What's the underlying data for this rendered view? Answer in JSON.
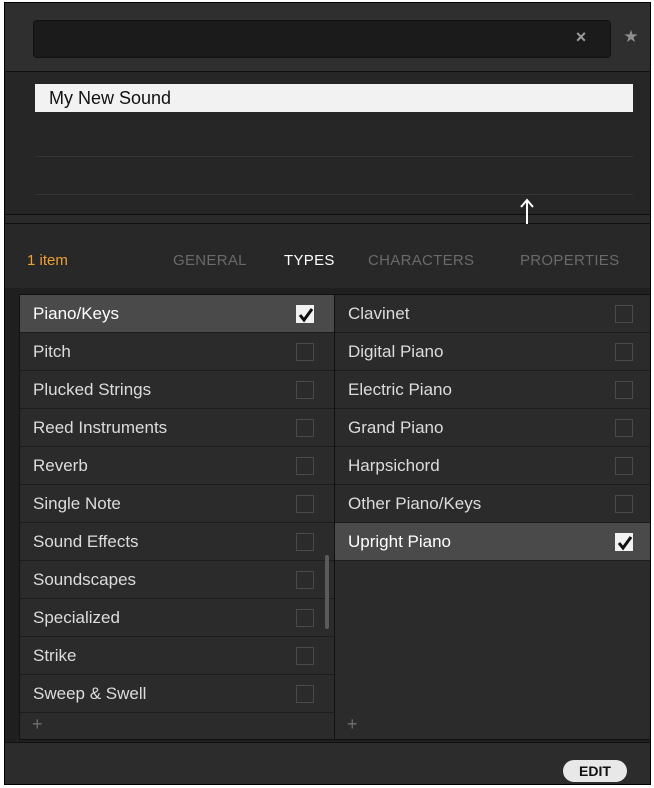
{
  "search": {
    "value": "",
    "placeholder": ""
  },
  "icons": {
    "clear": "×",
    "favorite": "★",
    "add": "+"
  },
  "results": [
    {
      "label": "My New Sound",
      "selected": true
    }
  ],
  "tags_header": {
    "item_count": "1 item",
    "tabs": [
      {
        "label": "GENERAL",
        "active": false
      },
      {
        "label": "TYPES",
        "active": true
      },
      {
        "label": "CHARACTERS",
        "active": false
      },
      {
        "label": "PROPERTIES",
        "active": false
      }
    ]
  },
  "left_column": [
    {
      "label": "Piano/Keys",
      "checked": true,
      "selected": true
    },
    {
      "label": "Pitch",
      "checked": false,
      "selected": false
    },
    {
      "label": "Plucked Strings",
      "checked": false,
      "selected": false
    },
    {
      "label": "Reed Instruments",
      "checked": false,
      "selected": false
    },
    {
      "label": "Reverb",
      "checked": false,
      "selected": false
    },
    {
      "label": "Single Note",
      "checked": false,
      "selected": false
    },
    {
      "label": "Sound Effects",
      "checked": false,
      "selected": false
    },
    {
      "label": "Soundscapes",
      "checked": false,
      "selected": false
    },
    {
      "label": "Specialized",
      "checked": false,
      "selected": false
    },
    {
      "label": "Strike",
      "checked": false,
      "selected": false
    },
    {
      "label": "Sweep & Swell",
      "checked": false,
      "selected": false
    }
  ],
  "right_column": [
    {
      "label": "Clavinet",
      "checked": false,
      "selected": false
    },
    {
      "label": "Digital Piano",
      "checked": false,
      "selected": false
    },
    {
      "label": "Electric Piano",
      "checked": false,
      "selected": false
    },
    {
      "label": "Grand Piano",
      "checked": false,
      "selected": false
    },
    {
      "label": "Harpsichord",
      "checked": false,
      "selected": false
    },
    {
      "label": "Other Piano/Keys",
      "checked": false,
      "selected": false
    },
    {
      "label": "Upright Piano",
      "checked": true,
      "selected": true
    }
  ],
  "footer": {
    "edit_label": "EDIT"
  },
  "colors": {
    "accent": "#f0a030",
    "panel_bg": "#1f1f1f",
    "row_selected": "#4a4a4a",
    "text": "#dcdcdc"
  }
}
